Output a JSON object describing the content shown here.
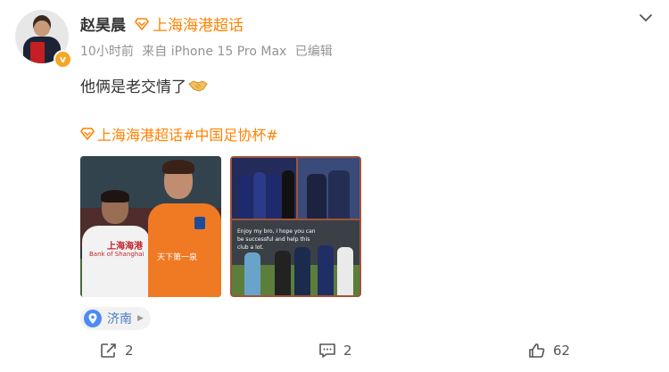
{
  "post": {
    "author": "赵昊晨",
    "author_topic": "上海海港超话",
    "time": "10小时前",
    "source": "来自 iPhone 15 Pro Max",
    "edited": "已编辑",
    "text": "他俩是老交情了",
    "text_emoji": "handshake",
    "tags": [
      "上海海港超话",
      "#中国足协杯#"
    ],
    "photo1_jersey_text": "上海海港",
    "photo1_jersey_sub": "Bank of Shanghai",
    "photo1_shirt_text": "天下第一泉",
    "photo2_caption": "Enjoy my bro, I hope you can be successful and help this club a lot.",
    "location": "济南",
    "actions": {
      "share_count": "2",
      "comment_count": "2",
      "like_count": "62"
    }
  },
  "colors": {
    "accent": "#ff8200",
    "verify": "#f5a623",
    "location_text": "#4c7dc2",
    "meta": "#939393"
  },
  "icons": {
    "topic": "diamond-icon",
    "menu": "chevron-down-icon",
    "location": "map-pin-icon",
    "share": "share-icon",
    "comment": "comment-icon",
    "like": "thumbs-up-icon"
  }
}
